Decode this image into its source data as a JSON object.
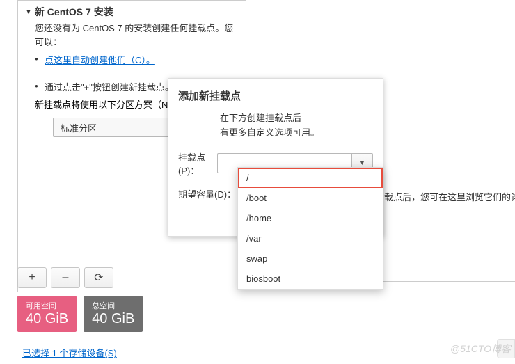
{
  "left": {
    "title": "新 CentOS 7 安装",
    "desc": "您还没有为 CentOS 7 的安装创建任何挂载点。您可以：",
    "auto_link": "点这里自动创建他们（C）。",
    "manual_text": "通过点击\"+\"按钮创建新挂载点。",
    "scheme_text": "新挂载点将使用以下分区方案（N）：",
    "scheme_value": "标准分区"
  },
  "buttons": {
    "add": "+",
    "remove": "–",
    "reload": "⟳"
  },
  "badges": {
    "avail_label": "可用空间",
    "avail_value": "40 GiB",
    "total_label": "总空间",
    "total_value": "40 GiB"
  },
  "storage_link": "已选择 1 个存储设备(S)",
  "right_info": "载点后，您可在这里浏览它们的详",
  "dialog": {
    "title": "添加新挂载点",
    "sub1": "在下方创建挂载点后",
    "sub2": "有更多自定义选项可用。",
    "mount_label": "挂载点(P)：",
    "size_label": "期望容量(D)：",
    "combo_value": "",
    "size_value": ""
  },
  "dropdown": {
    "items": [
      "/",
      "/boot",
      "/home",
      "/var",
      "swap",
      "biosboot"
    ],
    "selected_index": 0
  },
  "watermark": "@51CTO博客"
}
